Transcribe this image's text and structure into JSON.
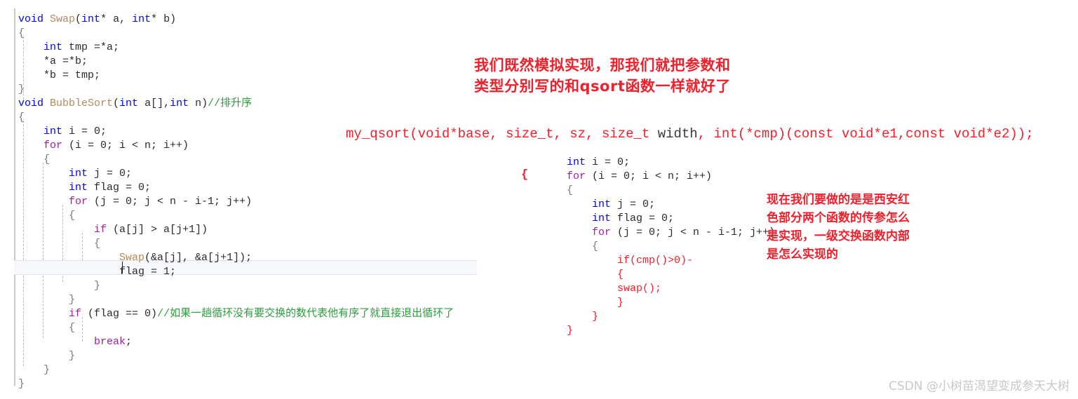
{
  "left_editor": {
    "name": "bubble-sort-source",
    "lines": [
      [
        {
          "t": "void ",
          "c": "kw"
        },
        {
          "t": "Swap",
          "c": "fn"
        },
        {
          "t": "(",
          "c": "punct"
        },
        {
          "t": "int",
          "c": "kw"
        },
        {
          "t": "* a, ",
          "c": "plain"
        },
        {
          "t": "int",
          "c": "kw"
        },
        {
          "t": "* b)",
          "c": "plain"
        }
      ],
      [
        {
          "t": "{",
          "c": "brace"
        }
      ],
      [
        {
          "t": "    ",
          "c": "plain"
        },
        {
          "t": "int",
          "c": "kw"
        },
        {
          "t": " tmp =*a;",
          "c": "plain"
        }
      ],
      [
        {
          "t": "    *a =*b;",
          "c": "plain"
        }
      ],
      [
        {
          "t": "    *b = tmp;",
          "c": "plain"
        }
      ],
      [
        {
          "t": "}",
          "c": "brace"
        }
      ],
      [
        {
          "t": "void ",
          "c": "kw"
        },
        {
          "t": "BubbleSort",
          "c": "fn"
        },
        {
          "t": "(",
          "c": "punct"
        },
        {
          "t": "int",
          "c": "kw"
        },
        {
          "t": " a[],",
          "c": "plain"
        },
        {
          "t": "int",
          "c": "kw"
        },
        {
          "t": " n)",
          "c": "plain"
        },
        {
          "t": "//排升序",
          "c": "cmt"
        }
      ],
      [
        {
          "t": "{",
          "c": "brace"
        }
      ],
      [
        {
          "t": "    ",
          "c": "plain"
        },
        {
          "t": "int",
          "c": "kw"
        },
        {
          "t": " i = 0;",
          "c": "plain"
        }
      ],
      [
        {
          "t": "    ",
          "c": "plain"
        },
        {
          "t": "for",
          "c": "ctl"
        },
        {
          "t": " (i = 0; i < n; i++)",
          "c": "plain"
        }
      ],
      [
        {
          "t": "    {",
          "c": "brace"
        }
      ],
      [
        {
          "t": "        ",
          "c": "plain"
        },
        {
          "t": "int",
          "c": "kw"
        },
        {
          "t": " j = 0;",
          "c": "plain"
        }
      ],
      [
        {
          "t": "        ",
          "c": "plain"
        },
        {
          "t": "int",
          "c": "kw"
        },
        {
          "t": " flag = 0;",
          "c": "plain"
        }
      ],
      [
        {
          "t": "        ",
          "c": "plain"
        },
        {
          "t": "for",
          "c": "ctl"
        },
        {
          "t": " (j = 0; j < n - i-1; j++)",
          "c": "plain"
        }
      ],
      [
        {
          "t": "        {",
          "c": "brace"
        }
      ],
      [
        {
          "t": "            ",
          "c": "plain"
        },
        {
          "t": "if",
          "c": "ctl"
        },
        {
          "t": " (a[j] > a[j+1])",
          "c": "plain"
        }
      ],
      [
        {
          "t": "            {",
          "c": "brace"
        }
      ],
      [
        {
          "t": "                ",
          "c": "plain"
        },
        {
          "t": "Swap",
          "c": "fn"
        },
        {
          "t": "(&a[j], &a[j+1]);",
          "c": "plain"
        }
      ],
      [
        {
          "t": "                flag = 1;",
          "c": "plain"
        }
      ],
      [
        {
          "t": "            }",
          "c": "brace"
        }
      ],
      [
        {
          "t": "        }",
          "c": "brace"
        }
      ],
      [
        {
          "t": "        ",
          "c": "plain"
        },
        {
          "t": "if",
          "c": "ctl"
        },
        {
          "t": " (flag == 0)",
          "c": "plain"
        },
        {
          "t": "//如果一趟循环没有要交换的数代表他有序了就直接退出循环了",
          "c": "cmt"
        }
      ],
      [
        {
          "t": "        {",
          "c": "brace"
        }
      ],
      [
        {
          "t": "            ",
          "c": "plain"
        },
        {
          "t": "break",
          "c": "ctl"
        },
        {
          "t": ";",
          "c": "plain"
        }
      ],
      [
        {
          "t": "        }",
          "c": "brace"
        }
      ],
      [
        {
          "t": "    }",
          "c": "brace"
        }
      ],
      [
        {
          "t": "}",
          "c": "brace"
        }
      ]
    ],
    "caret_after": "flag = 1;"
  },
  "annotation_top": "我们既然模拟实现，那我们就把参数和\n类型分别写的和qsort函数一样就好了",
  "signature": {
    "label": "my_qsort-signature",
    "parts": [
      {
        "t": "my_qsort(void*base, size_t, sz, size_t ",
        "c": "red"
      },
      {
        "t": "width",
        "c": "dark"
      },
      {
        "t": ", ",
        "c": "red"
      },
      {
        "t": "int(*cmp)(const void*e1,const void*e2));",
        "c": "red"
      }
    ]
  },
  "right_editor": {
    "name": "my-qsort-pseudo-source",
    "open_brace": "{",
    "lines": [
      [
        {
          "t": "    ",
          "c": "plain"
        },
        {
          "t": "int",
          "c": "kw"
        },
        {
          "t": " i = 0;",
          "c": "plain"
        }
      ],
      [
        {
          "t": "    ",
          "c": "plain"
        },
        {
          "t": "for",
          "c": "ctl"
        },
        {
          "t": " (i = 0; i < n; i++)",
          "c": "plain"
        }
      ],
      [
        {
          "t": "    {",
          "c": "brace"
        }
      ],
      [
        {
          "t": "        ",
          "c": "plain"
        },
        {
          "t": "int",
          "c": "kw"
        },
        {
          "t": " j = 0;",
          "c": "plain"
        }
      ],
      [
        {
          "t": "        ",
          "c": "plain"
        },
        {
          "t": "int",
          "c": "kw"
        },
        {
          "t": " flag = 0;",
          "c": "plain"
        }
      ],
      [
        {
          "t": "        ",
          "c": "plain"
        },
        {
          "t": "for",
          "c": "ctl"
        },
        {
          "t": " (j = 0; j < n - i-1; j++)",
          "c": "plain"
        }
      ],
      [
        {
          "t": "        {",
          "c": "brace"
        }
      ],
      [
        {
          "t": "            ",
          "c": "plain"
        },
        {
          "t": "if(cmp()>0)-",
          "c": "red"
        }
      ],
      [
        {
          "t": "            ",
          "c": "plain"
        },
        {
          "t": "{",
          "c": "red"
        }
      ],
      [
        {
          "t": "            ",
          "c": "plain"
        },
        {
          "t": "swap();",
          "c": "red"
        }
      ],
      [
        {
          "t": "            ",
          "c": "plain"
        },
        {
          "t": "}",
          "c": "red"
        }
      ],
      [
        {
          "t": "        ",
          "c": "plain"
        },
        {
          "t": "}",
          "c": "red"
        }
      ],
      [
        {
          "t": "    ",
          "c": "plain"
        },
        {
          "t": "}",
          "c": "red"
        }
      ]
    ]
  },
  "annotation_right": "现在我们要做的是是西安红\n色部分两个函数的传参怎么\n是实现，一级交换函数内部\n是怎么实现的",
  "watermark": "CSDN @小树苗渴望变成参天大树",
  "colors": {
    "red": "#f0212c",
    "keyword_blue": "#0000ff",
    "control_purple": "#a020a0",
    "function_tan": "#b48a5a",
    "comment_green": "#2e9b3e",
    "brace_gray": "#7a7a7a",
    "watermark_gray": "#c8c8c8"
  }
}
